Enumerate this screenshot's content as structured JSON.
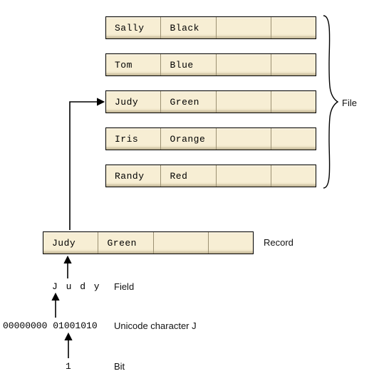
{
  "file": {
    "records": [
      {
        "name": "Sally",
        "color": "Black"
      },
      {
        "name": "Tom",
        "color": "Blue"
      },
      {
        "name": "Judy",
        "color": "Green"
      },
      {
        "name": "Iris",
        "color": "Orange"
      },
      {
        "name": "Randy",
        "color": "Red"
      }
    ],
    "label": "File"
  },
  "record": {
    "name": "Judy",
    "color": "Green",
    "label": "Record"
  },
  "field": {
    "value": "J u d y",
    "label": "Field"
  },
  "unicode_char": {
    "bits": "00000000 01001010",
    "label": "Unicode character J"
  },
  "bit": {
    "value": "1",
    "label": "Bit"
  }
}
